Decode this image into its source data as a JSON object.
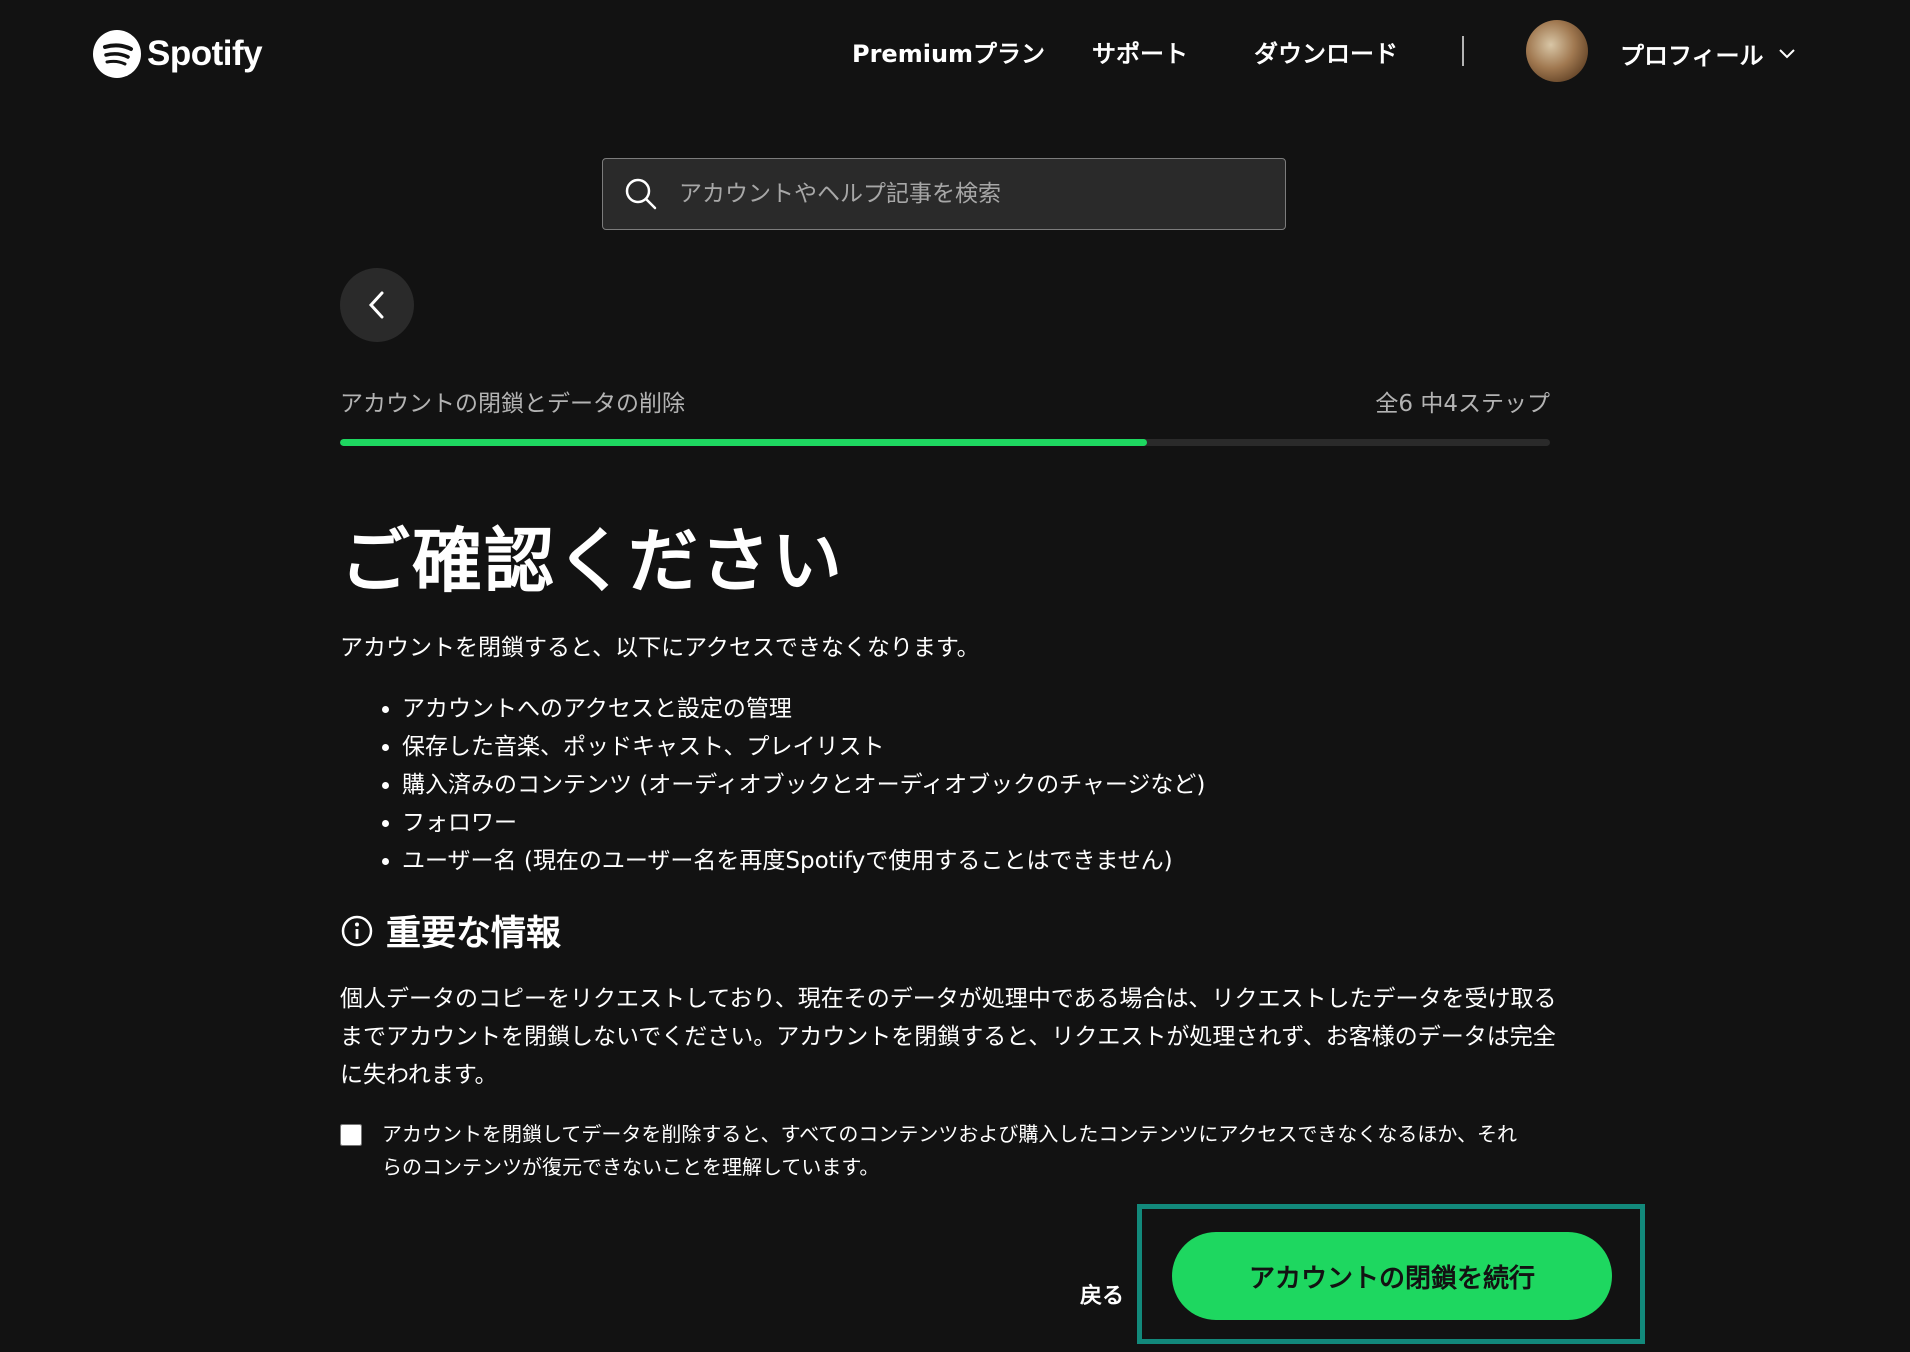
{
  "header": {
    "logo_text": "Spotify",
    "nav": {
      "premium": "Premiumプラン",
      "support": "サポート",
      "download": "ダウンロード",
      "profile": "プロフィール"
    }
  },
  "search": {
    "placeholder": "アカウントやヘルプ記事を検索"
  },
  "progress": {
    "title": "アカウントの閉鎖とデータの削除",
    "step_label": "全6 中4ステップ",
    "fraction": 0.667
  },
  "main": {
    "heading": "ご確認ください",
    "intro": "アカウントを閉鎖すると、以下にアクセスできなくなります。",
    "bullets": [
      "アカウントへのアクセスと設定の管理",
      "保存した音楽、ポッドキャスト、プレイリスト",
      "購入済みのコンテンツ (オーディオブックとオーディオブックのチャージなど)",
      "フォロワー",
      "ユーザー名 (現在のユーザー名を再度Spotifyで使用することはできません)"
    ],
    "important_heading": "重要な情報",
    "important_body": "個人データのコピーをリクエストしており、現在そのデータが処理中である場合は、リクエストしたデータを受け取るまでアカウントを閉鎖しないでください。アカウントを閉鎖すると、リクエストが処理されず、お客様のデータは完全に失われます。",
    "checkbox_label": "アカウントを閉鎖してデータを削除すると、すべてのコンテンツおよび購入したコンテンツにアクセスできなくなるほか、それらのコンテンツが復元できないことを理解しています。",
    "checkbox_checked": false
  },
  "actions": {
    "back_label": "戻る",
    "continue_label": "アカウントの閉鎖を続行"
  },
  "colors": {
    "background": "#121212",
    "accent": "#1ed760",
    "highlight_border": "#12897b"
  }
}
